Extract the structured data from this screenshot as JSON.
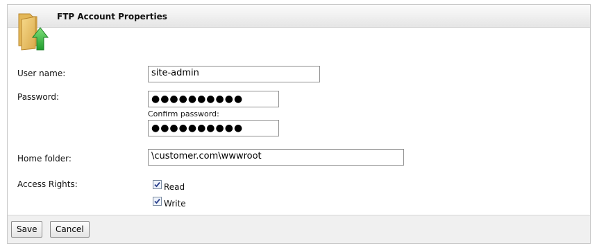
{
  "header": {
    "title": "FTP Account Properties",
    "icon": "folder-upload-icon"
  },
  "form": {
    "username": {
      "label": "User name:",
      "value": "site-admin"
    },
    "password": {
      "label": "Password:",
      "value": "●●●●●●●●●●"
    },
    "confirm_password": {
      "label": "Confirm password:",
      "value": "●●●●●●●●●●"
    },
    "home_folder": {
      "label": "Home folder:",
      "value": "\\customer.com\\wwwroot"
    },
    "access_rights": {
      "label": "Access Rights:",
      "read": {
        "label": "Read",
        "checked": true
      },
      "write": {
        "label": "Write",
        "checked": true
      }
    }
  },
  "footer": {
    "save_label": "Save",
    "cancel_label": "Cancel"
  }
}
